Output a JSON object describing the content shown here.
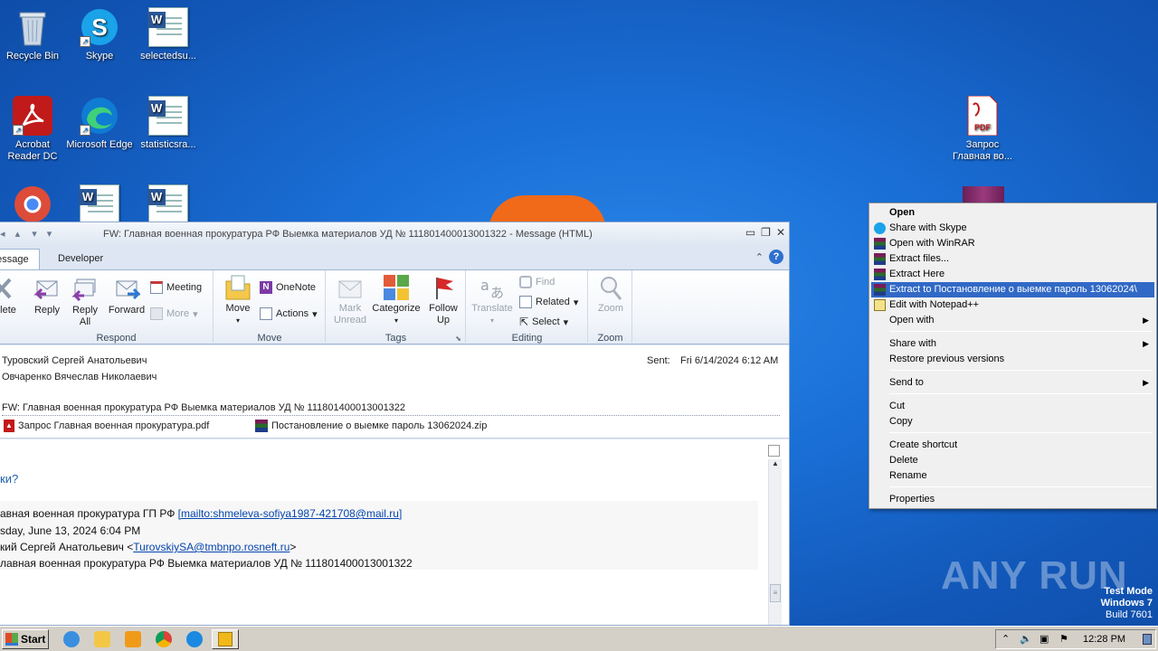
{
  "desktop": {
    "icons": [
      {
        "label": "Recycle Bin",
        "icon": "recycle-bin-icon"
      },
      {
        "label": "Skype",
        "icon": "skype-icon"
      },
      {
        "label": "selectedsu...",
        "icon": "word-doc-icon"
      },
      {
        "label": "Acrobat Reader DC",
        "icon": "acrobat-icon"
      },
      {
        "label": "Microsoft Edge",
        "icon": "edge-icon"
      },
      {
        "label": "statisticsra...",
        "icon": "word-doc-icon"
      },
      {
        "label": "Запрос Главная во...",
        "icon": "pdf-icon"
      }
    ],
    "watermark": {
      "brand": "ANY RUN",
      "mode": "Test Mode",
      "os": "Windows 7",
      "build": "Build 7601"
    }
  },
  "outlook": {
    "title": "FW: Главная военная прокуратура РФ Выемка материалов УД № 111801400013001322  -  Message (HTML)",
    "tabs": [
      "Message",
      "Developer"
    ],
    "groups": {
      "respond": "Respond",
      "move": "Move",
      "tags": "Tags",
      "editing": "Editing",
      "zoom": "Zoom"
    },
    "buttons": {
      "delete": "Delete",
      "reply": "Reply",
      "reply_all": "Reply All",
      "forward": "Forward",
      "meeting": "Meeting",
      "more": "More",
      "move": "Move",
      "onenote": "OneNote",
      "actions": "Actions",
      "mark_unread": "Mark Unread",
      "categorize": "Categorize",
      "follow_up": "Follow Up",
      "translate": "Translate",
      "find": "Find",
      "related": "Related",
      "select": "Select",
      "zoom": "Zoom"
    },
    "header": {
      "from": "Туровский Сергей Анатольевич",
      "to": "Овчаренко Вячеслав Николаевич",
      "sent_label": "Sent:",
      "sent_value": "Fri 6/14/2024 6:12 AM",
      "subject": "FW: Главная военная прокуратура РФ Выемка материалов УД № 111801400013001322",
      "attachments": [
        "Запрос Главная военная прокуратура.pdf",
        "Постановление о выемке  пароль 13062024.zip"
      ]
    },
    "body": {
      "line1": "ки?",
      "line2_prefix": "авная военная прокуратура ГП РФ ",
      "line2_link": "[mailto:shmeleva-sofiya1987-421708@mail.ru]",
      "line3": "sday, June 13, 2024 6:04 PM",
      "line4_prefix": "кий Сергей Анатольевич <",
      "line4_link": "TurovskiySA@tmbnpo.rosneft.ru",
      "line4_suffix": ">",
      "line5": "лавная военная прокуратура РФ Выемка материалов УД № 111801400013001322"
    }
  },
  "context_menu": {
    "items": [
      {
        "label": "Open",
        "bold": true
      },
      {
        "label": "Share with Skype",
        "icon": "skype-icon"
      },
      {
        "label": "Open with WinRAR",
        "icon": "winrar-icon"
      },
      {
        "label": "Extract files...",
        "icon": "winrar-icon"
      },
      {
        "label": "Extract Here",
        "icon": "winrar-icon"
      },
      {
        "label": "Extract to Постановление о выемке  пароль 13062024\\",
        "icon": "winrar-icon",
        "highlighted": true
      },
      {
        "label": "Edit with Notepad++",
        "icon": "notepadpp-icon"
      },
      {
        "label": "Open with",
        "submenu": true
      },
      {
        "label": "Share with",
        "submenu": true
      },
      {
        "label": "Restore previous versions"
      },
      {
        "label": "Send to",
        "submenu": true
      },
      {
        "label": "Cut"
      },
      {
        "label": "Copy"
      },
      {
        "label": "Create shortcut"
      },
      {
        "label": "Delete"
      },
      {
        "label": "Rename"
      },
      {
        "label": "Properties"
      }
    ]
  },
  "taskbar": {
    "start": "Start",
    "clock": "12:28 PM"
  }
}
